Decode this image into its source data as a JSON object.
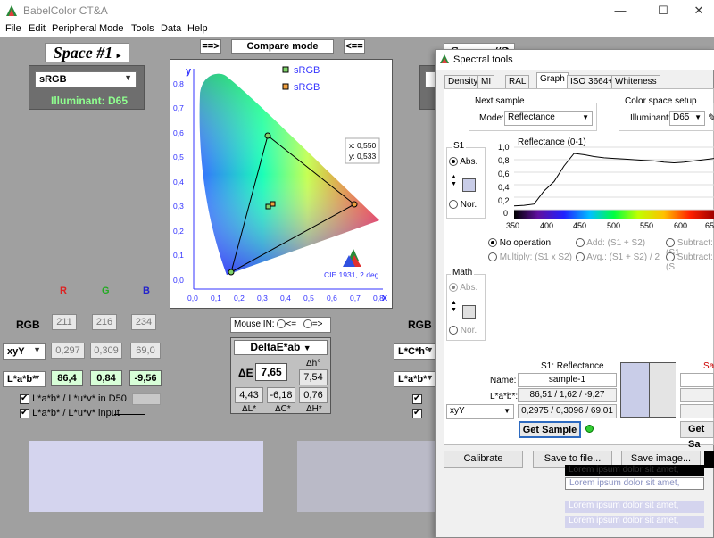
{
  "app": {
    "title": "BabelColor CT&A"
  },
  "menu": [
    "File",
    "Edit",
    "Peripheral",
    "Mode",
    "Tools",
    "Data",
    "Help"
  ],
  "left": {
    "space_title": "Space #1",
    "space_arrow": "▸",
    "color_space": "sRGB",
    "illuminant": "Illuminant: D65",
    "rgb_headers": [
      "R",
      "G",
      "B"
    ],
    "rgb_label": "RGB",
    "rgb": [
      "211",
      "216",
      "234"
    ],
    "xyY_label": "xyY",
    "xyY": [
      "0,297",
      "0,309",
      "69,0"
    ],
    "lab_label": "L*a*b*",
    "lab": [
      "86,4",
      "0,84",
      "-9,56"
    ],
    "chk1": "L*a*b* / L*u*v* in D50",
    "chk2": "L*a*b* / L*u*v* input"
  },
  "compare": {
    "left_btn": "==>",
    "label": "Compare mode",
    "right_btn": "<=="
  },
  "plot": {
    "legend": [
      "sRGB",
      "sRGB"
    ],
    "x_label": "x",
    "y_label": "y",
    "coord_x": "x: 0,550",
    "coord_y": "y: 0,533",
    "caption": "CIE 1931, 2 deg.",
    "x_ticks": [
      "0,0",
      "0,1",
      "0,2",
      "0,3",
      "0,4",
      "0,5",
      "0,6",
      "0,7",
      "0,8"
    ],
    "y_ticks": [
      "0,0",
      "0,1",
      "0,2",
      "0,3",
      "0,4",
      "0,5",
      "0,6",
      "0,7",
      "0,8"
    ],
    "colors": {
      "tri1": "#7fd36a",
      "tri2": "#f0a040"
    }
  },
  "mouse_in": {
    "label": "Mouse IN:",
    "opt1": "<=",
    "opt2": "=>"
  },
  "delta": {
    "title": "DeltaE*ab",
    "dE_label": "ΔE",
    "dE": "7,65",
    "dh_label": "Δh°",
    "dh": "7,54",
    "dL": "4,43",
    "dC": "-6,18",
    "dH": "0,76",
    "dL_label": "ΔL*",
    "dC_label": "ΔC*",
    "dH_label": "ΔH*"
  },
  "right": {
    "space_title": "Space #2",
    "rgb_label": "RGB",
    "xyY_label": "L*C*h°",
    "lab_label": "L*a*b*"
  },
  "lorem": [
    "Lorem ipsum dolor sit amet,",
    "Lorem ipsum dolor sit amet,",
    "Lorem ipsum dolor sit amet,",
    "Lorem ipsum dolor sit amet,"
  ],
  "spectral": {
    "title": "Spectral tools",
    "tabs": [
      "Density",
      "MI",
      "RAL",
      "Graph",
      "ISO 3664+",
      "Whiteness"
    ],
    "next_sample": "Next sample",
    "mode_label": "Mode:",
    "mode": "Reflectance",
    "cs_setup": "Color space setup",
    "ill_label": "Illuminant:",
    "ill": "D65",
    "s1": "S1",
    "abs": "Abs.",
    "nor": "Nor.",
    "graph_title": "Reflectance (0-1)",
    "y_ticks": [
      "1,0",
      "0,8",
      "0,6",
      "0,4",
      "0,2",
      "0"
    ],
    "x_ticks": [
      "350",
      "400",
      "450",
      "500",
      "550",
      "600",
      "65"
    ],
    "ops": [
      "No operation",
      "Add: (S1 + S2)",
      "Subtract: (S1",
      "Multiply: (S1 x S2)",
      "Avg.: (S1 + S2) / 2",
      "Subtract: (S"
    ],
    "math": "Math",
    "math_abs": "Abs.",
    "math_nor": "Nor.",
    "s1_header": "S1: Reflectance",
    "s2_header": "Sa",
    "name_label": "Name:",
    "name": "sample-1",
    "lab_label": "L*a*b*:",
    "lab": "86,51 / 1,62 / -9,27",
    "xyY_sel": "xyY",
    "xyY": "0,2975 / 0,3096 / 69,01",
    "get_sample": "Get Sample",
    "get_sample2": "Get Sa",
    "calibrate": "Calibrate",
    "save_file": "Save to file...",
    "save_image": "Save image...",
    "reflectance": [
      0.06,
      0.07,
      0.09,
      0.3,
      0.45,
      0.7,
      0.9,
      0.88,
      0.85,
      0.83,
      0.82,
      0.81,
      0.8,
      0.79,
      0.78,
      0.76,
      0.75,
      0.76,
      0.78,
      0.8,
      0.82
    ]
  }
}
